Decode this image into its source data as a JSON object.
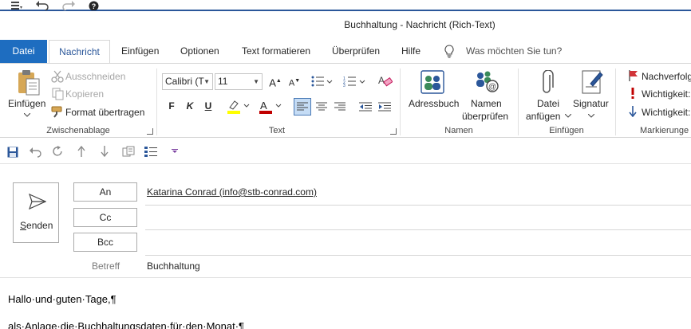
{
  "window": {
    "title": "Buchhaltung  -  Nachricht (Rich-Text)"
  },
  "tabs": [
    "Datei",
    "Nachricht",
    "Einfügen",
    "Optionen",
    "Text formatieren",
    "Überprüfen",
    "Hilfe"
  ],
  "tell_me": {
    "placeholder": "Was möchten Sie tun?"
  },
  "ribbon": {
    "clipboard": {
      "paste_label": "Einfügen",
      "cut_label": "Ausschneiden",
      "copy_label": "Kopieren",
      "format_painter_label": "Format übertragen",
      "group_label": "Zwischenablage"
    },
    "text": {
      "font_name": "Calibri (T",
      "font_size": "11",
      "group_label": "Text"
    },
    "names": {
      "address_book_label": "Adressbuch",
      "check_names_line1": "Namen",
      "check_names_line2": "überprüfen",
      "group_label": "Namen"
    },
    "include": {
      "attach_line1": "Datei",
      "attach_line2": "anfügen",
      "signature_label": "Signatur",
      "group_label": "Einfügen"
    },
    "tags": {
      "follow_up_label": "Nachverfolg",
      "importance_high_label": "Wichtigkeit:",
      "importance_low_label": "Wichtigkeit:",
      "group_label": "Markierunge"
    }
  },
  "compose": {
    "send_label": "Senden",
    "to_label": "An",
    "cc_label": "Cc",
    "bcc_label": "Bcc",
    "to_value": "Katarina Conrad (info@stb-conrad.com)",
    "subject_label": "Betreff",
    "subject_value": "Buchhaltung"
  },
  "body": {
    "line1": "Hallo·und·guten·Tage,¶",
    "line2": "als·Anlage·die·Buchhaltungsdaten·für·den·Monat·¶"
  },
  "colors": {
    "accent": "#2b579a",
    "file_tab": "#1e6dc0",
    "highlight": "#ffff00",
    "font_color": "#c00000",
    "flag": "#d13438",
    "importance_high": "#c00000",
    "importance_low": "#2b579a"
  }
}
